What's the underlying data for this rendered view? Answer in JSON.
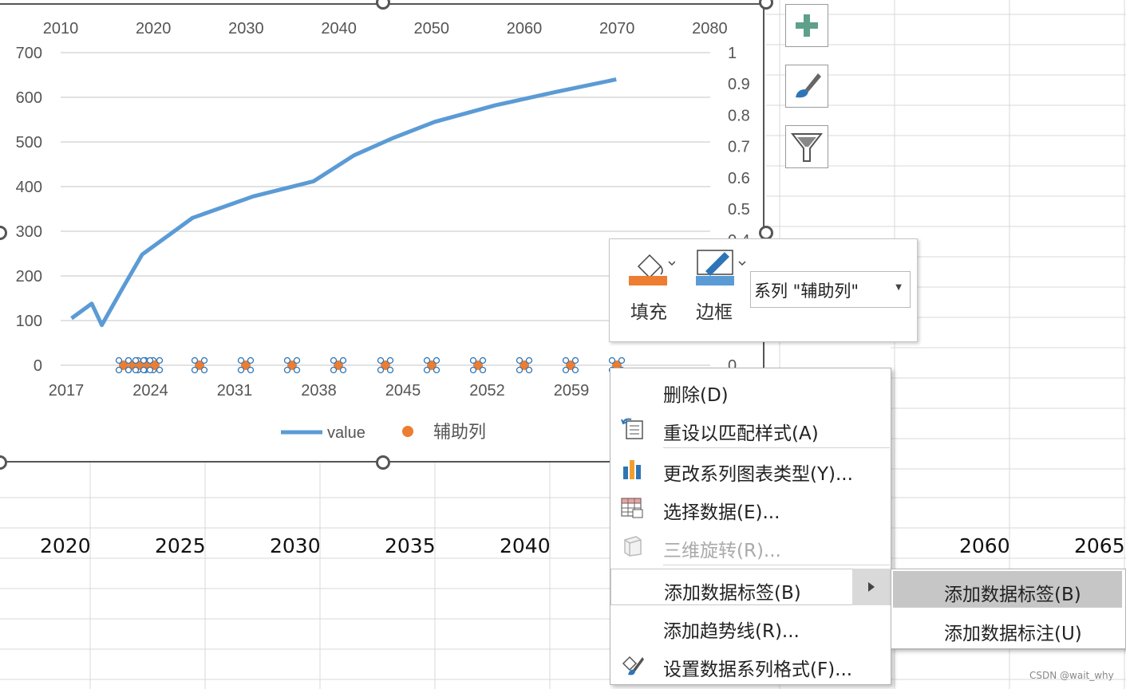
{
  "chart_data": {
    "type": "line",
    "title": "",
    "secondary_x_ticks": [
      "2010",
      "2020",
      "2030",
      "2040",
      "2050",
      "2060",
      "2070",
      "2080"
    ],
    "primary_y_ticks": [
      "700",
      "600",
      "500",
      "400",
      "300",
      "200",
      "100",
      "0"
    ],
    "secondary_y_ticks": [
      "1",
      "0.9",
      "0.8",
      "0.7",
      "0.6",
      "0.5",
      "0.4",
      "0"
    ],
    "x_ticks": [
      "2017",
      "2024",
      "2031",
      "2038",
      "2045",
      "2052",
      "2059"
    ],
    "ylim": [
      0,
      700
    ],
    "grid": true,
    "legend_position": "bottom",
    "series": [
      {
        "name": "value",
        "color": "#5B9BD5",
        "axis": "primary",
        "x": [
          2017,
          2019,
          2020,
          2022,
          2024,
          2029,
          2035,
          2041,
          2045,
          2049,
          2053,
          2059,
          2065,
          2071
        ],
        "values": [
          105,
          138,
          90,
          170,
          248,
          330,
          378,
          412,
          470,
          510,
          545,
          582,
          612,
          640
        ]
      },
      {
        "name": "辅助列",
        "color": "#ED7D31",
        "axis": "secondary",
        "type": "scatter",
        "x": [
          2020,
          2021,
          2022,
          2023,
          2024,
          2025,
          2030,
          2035,
          2040,
          2045,
          2050,
          2055,
          2060,
          2065,
          2070
        ],
        "values": [
          0,
          0,
          0,
          0,
          0,
          0,
          0,
          0,
          0,
          0,
          0,
          0,
          0,
          0,
          0
        ]
      }
    ],
    "legend": [
      "value",
      "辅助列"
    ]
  },
  "sheet": {
    "row_labels": [
      "2020",
      "2025",
      "2030",
      "2035",
      "2040",
      "2060",
      "2065"
    ]
  },
  "format_bar": {
    "fill_label": "填充",
    "border_label": "边框",
    "series_select": "系列 \"辅助列\""
  },
  "context_menu": {
    "items": [
      {
        "label": "删除(D)",
        "icon": "none"
      },
      {
        "label": "重设以匹配样式(A)",
        "icon": "reset-style-icon"
      },
      {
        "label": "更改系列图表类型(Y)...",
        "icon": "chart-type-icon"
      },
      {
        "label": "选择数据(E)...",
        "icon": "select-data-icon"
      },
      {
        "label": "三维旋转(R)...",
        "icon": "3d-rotate-icon",
        "disabled": true
      },
      {
        "label": "添加数据标签(B)",
        "icon": "none",
        "submenu": true
      },
      {
        "label": "添加趋势线(R)...",
        "icon": "none"
      },
      {
        "label": "设置数据系列格式(F)...",
        "icon": "format-series-icon"
      }
    ]
  },
  "submenu": {
    "items": [
      {
        "label": "添加数据标签(B)"
      },
      {
        "label": "添加数据标注(U)"
      }
    ]
  },
  "watermark": "CSDN @wait_why"
}
